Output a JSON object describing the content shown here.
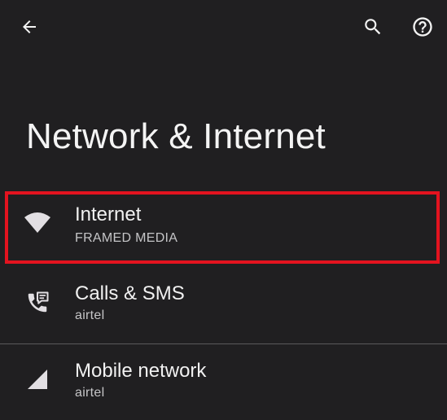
{
  "topbar": {
    "back_icon": "arrow-back-icon",
    "search_icon": "search-icon",
    "help_icon": "help-circle-icon"
  },
  "page": {
    "title": "Network & Internet"
  },
  "items": [
    {
      "title": "Internet",
      "subtitle": "FRAMED MEDIA",
      "icon": "wifi-icon",
      "highlighted": true
    },
    {
      "title": "Calls & SMS",
      "subtitle": "airtel",
      "icon": "phone-message-icon"
    },
    {
      "title": "Mobile network",
      "subtitle": "airtel",
      "icon": "signal-icon"
    }
  ],
  "colors": {
    "background": "#201f21",
    "highlight": "#e3131f",
    "icon": "#e2dfe3"
  }
}
